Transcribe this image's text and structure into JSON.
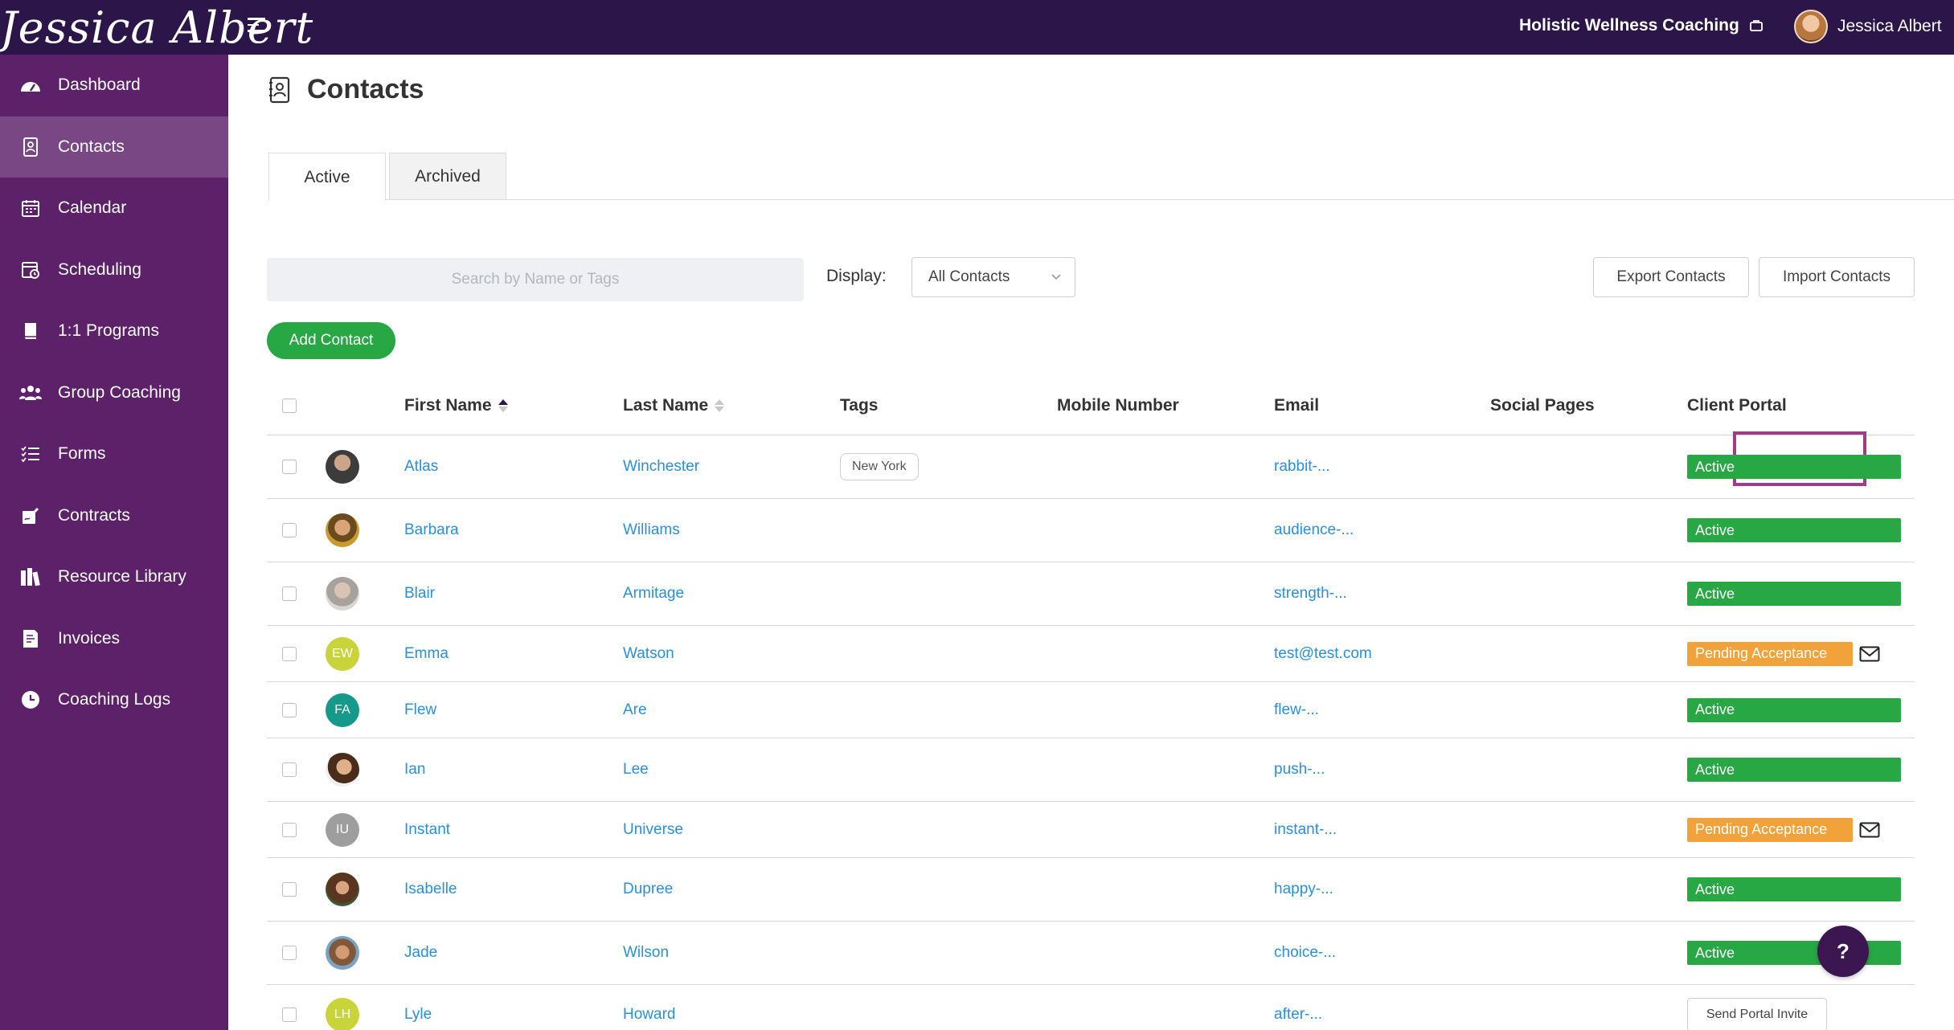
{
  "header": {
    "brand": "Jessica Albert",
    "business_name": "Holistic Wellness Coaching",
    "user_name": "Jessica Albert"
  },
  "sidebar": {
    "items": [
      {
        "label": "Dashboard",
        "icon": "dashboard-icon"
      },
      {
        "label": "Contacts",
        "icon": "contacts-icon",
        "active": true
      },
      {
        "label": "Calendar",
        "icon": "calendar-icon"
      },
      {
        "label": "Scheduling",
        "icon": "scheduling-icon"
      },
      {
        "label": "1:1 Programs",
        "icon": "book-icon"
      },
      {
        "label": "Group Coaching",
        "icon": "group-icon"
      },
      {
        "label": "Forms",
        "icon": "forms-icon"
      },
      {
        "label": "Contracts",
        "icon": "contract-icon"
      },
      {
        "label": "Resource Library",
        "icon": "library-icon"
      },
      {
        "label": "Invoices",
        "icon": "invoice-icon"
      },
      {
        "label": "Coaching Logs",
        "icon": "clock-icon"
      }
    ]
  },
  "page": {
    "title": "Contacts",
    "tabs": [
      "Active",
      "Archived"
    ],
    "search_placeholder": "Search by Name or Tags",
    "display_label": "Display:",
    "display_value": "All Contacts",
    "export_label": "Export Contacts",
    "import_label": "Import Contacts",
    "add_label": "Add Contact"
  },
  "table": {
    "columns": [
      "First Name",
      "Last Name",
      "Tags",
      "Mobile Number",
      "Email",
      "Social Pages",
      "Client Portal"
    ],
    "rows": [
      {
        "first": "Atlas",
        "last": "Winchester",
        "tag": "New York",
        "email": "rabbit-...",
        "portal": "Active"
      },
      {
        "first": "Barbara",
        "last": "Williams",
        "tag": "",
        "email": "audience-...",
        "portal": "Active"
      },
      {
        "first": "Blair",
        "last": "Armitage",
        "tag": "",
        "email": "strength-...",
        "portal": "Active"
      },
      {
        "first": "Emma",
        "last": "Watson",
        "tag": "",
        "email": "test@test.com",
        "portal": "Pending Acceptance",
        "initials": "EW"
      },
      {
        "first": "Flew",
        "last": "Are",
        "tag": "",
        "email": "flew-...",
        "portal": "Active",
        "initials": "FA"
      },
      {
        "first": "Ian",
        "last": "Lee",
        "tag": "",
        "email": "push-...",
        "portal": "Active"
      },
      {
        "first": "Instant",
        "last": "Universe",
        "tag": "",
        "email": "instant-...",
        "portal": "Pending Acceptance",
        "initials": "IU"
      },
      {
        "first": "Isabelle",
        "last": "Dupree",
        "tag": "",
        "email": "happy-...",
        "portal": "Active"
      },
      {
        "first": "Jade",
        "last": "Wilson",
        "tag": "",
        "email": "choice-...",
        "portal": "Active"
      },
      {
        "first": "Lyle",
        "last": "Howard",
        "tag": "",
        "email": "after-...",
        "portal": "Send Portal Invite",
        "initials": "LH"
      }
    ]
  },
  "help_label": "?",
  "colors": {
    "topbar": "#2b1549",
    "sidebar": "#5c2169",
    "sidebar_active": "#7a4785",
    "active_green": "#27a844",
    "pending_orange": "#f2a23a",
    "link_blue": "#2a8fdc",
    "highlight": "#a23b8e"
  }
}
